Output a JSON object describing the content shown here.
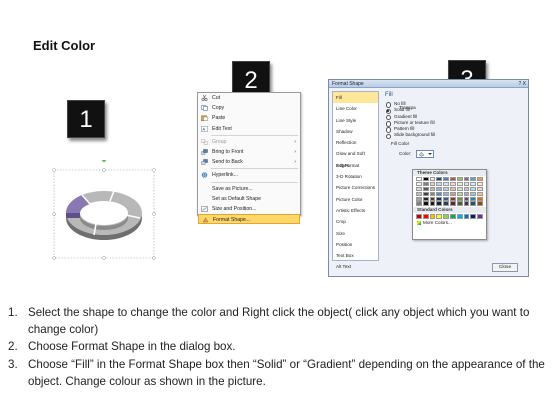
{
  "title": "Edit Color",
  "steps": [
    "1",
    "2",
    "3"
  ],
  "context_menu": {
    "items": [
      {
        "label": "Cut",
        "icon": "scissors-icon",
        "submenu": false,
        "disabled": false
      },
      {
        "label": "Copy",
        "icon": "copy-icon",
        "submenu": false,
        "disabled": false
      },
      {
        "label": "Paste",
        "icon": "paste-icon",
        "submenu": false,
        "disabled": false
      },
      {
        "label": "Edit Text",
        "icon": "edit-text-icon",
        "submenu": false,
        "disabled": false
      },
      {
        "label": "Group",
        "icon": "group-icon",
        "submenu": true,
        "disabled": true
      },
      {
        "label": "Bring to Front",
        "icon": "bring-front-icon",
        "submenu": true,
        "disabled": false
      },
      {
        "label": "Send to Back",
        "icon": "send-back-icon",
        "submenu": true,
        "disabled": false
      },
      {
        "label": "Hyperlink...",
        "icon": "hyperlink-icon",
        "submenu": false,
        "disabled": false
      },
      {
        "label": "Save as Picture...",
        "icon": "",
        "submenu": false,
        "disabled": false
      },
      {
        "label": "Set as Default Shape",
        "icon": "",
        "submenu": false,
        "disabled": false
      },
      {
        "label": "Size and Position...",
        "icon": "size-position-icon",
        "submenu": false,
        "disabled": false
      },
      {
        "label": "Format Shape...",
        "icon": "format-shape-icon",
        "submenu": false,
        "disabled": false,
        "highlighted": true
      }
    ]
  },
  "dialog": {
    "title": "Format Shape",
    "controls": "? X",
    "nav": [
      "Fill",
      "Line Color",
      "Line Style",
      "Shadow",
      "Reflection",
      "Glow and Soft Edges",
      "3-D Format",
      "3-D Rotation",
      "Picture Corrections",
      "Picture Color",
      "Artistic Effects",
      "Crop",
      "Size",
      "Position",
      "Text Box",
      "Alt Text"
    ],
    "selected_nav": "Fill",
    "fill_heading": "Fill",
    "options": [
      "No fill",
      "Solid fill",
      "Gradient fill",
      "Picture or texture fill",
      "Pattern fill",
      "Slide background fill"
    ],
    "selected_option": "Solid fill",
    "fill_color_label": "Fill Color",
    "color_label": "Color:",
    "transparency_label": "Transpa",
    "close_label": "Close"
  },
  "palette": {
    "theme_colors_label": "Theme Colors",
    "standard_colors_label": "Standard Colors",
    "more_colors_label": "More Colors...",
    "theme_rows": [
      [
        "#ffffff",
        "#000000",
        "#eeece1",
        "#1f497d",
        "#4f81bd",
        "#c0504d",
        "#9bbb59",
        "#8064a2",
        "#4bacc6",
        "#f79646"
      ],
      [
        "#f2f2f2",
        "#7f7f7f",
        "#ddd9c3",
        "#c6d9f0",
        "#dbe5f1",
        "#f2dcdb",
        "#ebf1dd",
        "#e5e0ec",
        "#dbeef3",
        "#fdeada"
      ],
      [
        "#d8d8d8",
        "#595959",
        "#c4bd97",
        "#8db3e2",
        "#b8cce4",
        "#e5b9b7",
        "#d7e3bc",
        "#ccc1d9",
        "#b7dde8",
        "#fbd5b5"
      ],
      [
        "#bfbfbf",
        "#3f3f3f",
        "#938953",
        "#548dd4",
        "#95b3d7",
        "#d99694",
        "#c3d69b",
        "#b2a2c7",
        "#92cddc",
        "#fac08f"
      ],
      [
        "#a5a5a5",
        "#262626",
        "#494429",
        "#17365d",
        "#366092",
        "#953734",
        "#76923c",
        "#5f497a",
        "#31859b",
        "#e36c09"
      ],
      [
        "#7f7f7f",
        "#0c0c0c",
        "#1d1b10",
        "#0f243e",
        "#244061",
        "#632423",
        "#4f6128",
        "#3f3151",
        "#205867",
        "#974806"
      ]
    ],
    "standard_row": [
      "#c00000",
      "#ff0000",
      "#ffc000",
      "#ffff00",
      "#92d050",
      "#00b050",
      "#00b0f0",
      "#0070c0",
      "#002060",
      "#7030a0"
    ]
  },
  "instructions": [
    {
      "num": "1.",
      "text": "Select the shape to change the color and Right click the object( click any object which you want to change color)"
    },
    {
      "num": "2.",
      "text": "Choose Format Shape in the dialog box."
    },
    {
      "num": "3.",
      "text": "Choose “Fill” in the Format Shape box then “Solid” or “Gradient” depending on the appearance of the object. Change colour as shown in the picture."
    }
  ]
}
